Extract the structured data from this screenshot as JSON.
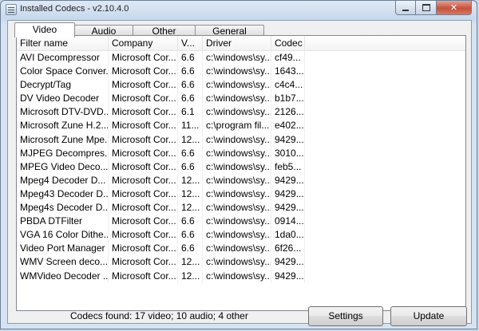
{
  "window": {
    "title": "Installed Codecs - v2.10.4.0"
  },
  "tabs": [
    {
      "label": "Video"
    },
    {
      "label": "Audio"
    },
    {
      "label": "Other"
    },
    {
      "label": "General"
    }
  ],
  "table": {
    "columns": [
      "Filter name",
      "Company",
      "V...",
      "Driver",
      "Codec"
    ],
    "rows": [
      [
        "AVI Decompressor",
        "Microsoft Cor...",
        "6.6",
        "c:\\windows\\sy...",
        "cf49..."
      ],
      [
        "Color Space Conver...",
        "Microsoft Cor...",
        "6.6",
        "c:\\windows\\sy...",
        "1643..."
      ],
      [
        "Decrypt/Tag",
        "Microsoft Cor...",
        "6.6",
        "c:\\windows\\sy...",
        "c4c4..."
      ],
      [
        "DV Video Decoder",
        "Microsoft Cor...",
        "6.6",
        "c:\\windows\\sy...",
        "b1b7..."
      ],
      [
        "Microsoft DTV-DVD...",
        "Microsoft Cor...",
        "6.1",
        "c:\\windows\\sy...",
        "2126..."
      ],
      [
        "Microsoft Zune H.2...",
        "Microsoft Cor...",
        "11...",
        "c:\\program fil...",
        "e402..."
      ],
      [
        "Microsoft Zune Mpe...",
        "Microsoft Cor...",
        "12...",
        "c:\\windows\\sy...",
        "9429..."
      ],
      [
        "MJPEG Decompres...",
        "Microsoft Cor...",
        "6.6",
        "c:\\windows\\sy...",
        "3010..."
      ],
      [
        "MPEG Video Deco...",
        "Microsoft Cor...",
        "6.6",
        "c:\\windows\\sy...",
        "feb5..."
      ],
      [
        "Mpeg4 Decoder D...",
        "Microsoft Cor...",
        "12...",
        "c:\\windows\\sy...",
        "9429..."
      ],
      [
        "Mpeg43 Decoder D...",
        "Microsoft Cor...",
        "12...",
        "c:\\windows\\sy...",
        "9429..."
      ],
      [
        "Mpeg4s Decoder D...",
        "Microsoft Cor...",
        "12...",
        "c:\\windows\\sy...",
        "9429..."
      ],
      [
        "PBDA DTFilter",
        "Microsoft Cor...",
        "6.6",
        "c:\\windows\\sy...",
        "0914..."
      ],
      [
        "VGA 16 Color Dithe...",
        "Microsoft Cor...",
        "6.6",
        "c:\\windows\\sy...",
        "1da0..."
      ],
      [
        "Video Port Manager",
        "Microsoft Cor...",
        "6.6",
        "c:\\windows\\sy...",
        "6f26..."
      ],
      [
        "WMV Screen deco...",
        "Microsoft Cor...",
        "12...",
        "c:\\windows\\sy...",
        "9429..."
      ],
      [
        "WMVideo Decoder ...",
        "Microsoft Cor...",
        "12...",
        "c:\\windows\\sy...",
        "9429..."
      ]
    ]
  },
  "status": {
    "text": "Codecs found: 17 video; 10 audio; 4 other"
  },
  "buttons": {
    "settings": "Settings",
    "update": "Update"
  }
}
